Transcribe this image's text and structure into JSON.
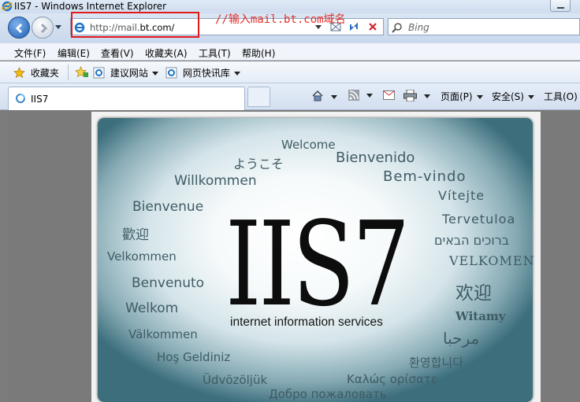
{
  "window": {
    "title": "IIS7 - Windows Internet Explorer"
  },
  "address": {
    "url_prefix": "http://mail.",
    "url_domain": "bt.com/"
  },
  "annotation": "//输入mail.bt.com域名",
  "search": {
    "placeholder": "Bing"
  },
  "menu": [
    "文件(F)",
    "编辑(E)",
    "查看(V)",
    "收藏夹(A)",
    "工具(T)",
    "帮助(H)"
  ],
  "favorites": {
    "favorites_label": "收藏夹",
    "suggested_sites": "建议网站",
    "web_slice_gallery": "网页快讯库"
  },
  "tab": {
    "title": "IIS7"
  },
  "commands": {
    "page": "页面(P)",
    "safety": "安全(S)",
    "tools": "工具(O)"
  },
  "welcome_page": {
    "logo": "IIS7",
    "subtitle": "internet information services",
    "greetings": [
      "Welcome",
      "ようこそ",
      "Bienvenido",
      "Willkommen",
      "Bem-vindo",
      "Bienvenue",
      "Vítejte",
      "Tervetuloa",
      "歡迎",
      "ברוכים הבאים",
      "Velkommen",
      "VELKOMEN",
      "Benvenuto",
      "欢迎",
      "Welkom",
      "Witamy",
      "Välkommen",
      "مرحبا",
      "Hoş Geldiniz",
      "환영합니다",
      "Üdvözöljük",
      "Καλώς ορίσατε",
      "Добро пожаловать"
    ]
  }
}
